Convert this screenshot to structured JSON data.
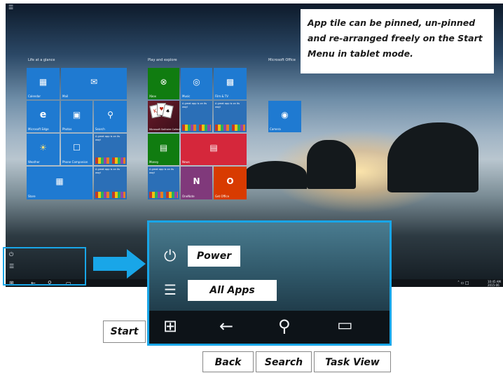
{
  "callout": {
    "text": "App tile can be pinned, un-pinned and re-arranged freely on the Start Menu in tablet mode."
  },
  "start_screen": {
    "sections": {
      "life": "Life at a glance",
      "play": "Play and explore",
      "office": "Microsoft Office"
    },
    "tiles": {
      "calendar": "Calendar",
      "mail": "Mail",
      "edge": "Microsoft Edge",
      "photos": "Photos",
      "search": "Search",
      "weather": "Weather",
      "phone": "Phone Companion",
      "store": "Store",
      "xbox": "Xbox",
      "music": "Music",
      "movies": "Film & TV",
      "solitaire": "Microsoft Solitaire Collection",
      "money": "Money",
      "news": "News",
      "onenote": "OneNote",
      "getoffice": "Get Office",
      "camera": "Camera",
      "promo": "A great app is on its way!"
    }
  },
  "taskbar": {
    "time": "10:45 AM",
    "date": "2015-06"
  },
  "zoom": {
    "power_label": "Power",
    "all_apps_label": "All Apps"
  },
  "labels": {
    "start": "Start",
    "back": "Back",
    "search": "Search",
    "task_view": "Task View"
  },
  "icons": [
    "hamburger-icon",
    "power-icon",
    "all-apps-icon",
    "windows-logo-icon",
    "back-arrow-icon",
    "search-icon",
    "task-view-icon"
  ],
  "colors": {
    "accent": "#19a6e8",
    "tile_blue": "#1f7ad1",
    "tile_green": "#107c10",
    "tile_red": "#d5273b"
  }
}
